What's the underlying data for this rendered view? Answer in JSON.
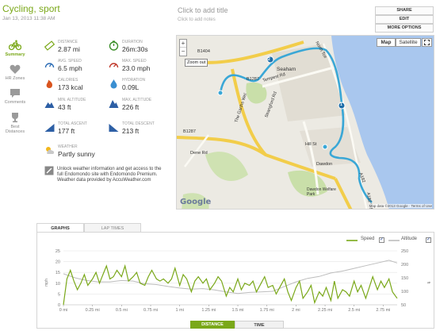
{
  "header": {
    "workout_title": "Cycling, sport",
    "workout_date": "Jan 13, 2013 11:38 AM",
    "add_title": "Click to add title",
    "add_notes": "Click to add notes"
  },
  "actions": [
    "SHARE",
    "EDIT",
    "MORE OPTIONS"
  ],
  "nav": [
    {
      "label": "Summary",
      "icon": "bicycle-icon"
    },
    {
      "label": "HR Zones",
      "icon": "heart-icon"
    },
    {
      "label": "Comments",
      "icon": "comment-icon"
    },
    {
      "label": "Best Distances",
      "icon": "trophy-icon"
    }
  ],
  "stats": [
    {
      "label": "DISTANCE",
      "value": "2.87 mi",
      "icon": "ruler-icon"
    },
    {
      "label": "DURATION",
      "value": "26m:30s",
      "icon": "stopwatch-icon"
    },
    {
      "label": "AVG. SPEED",
      "value": "6.5 mph",
      "icon": "speedometer-icon"
    },
    {
      "label": "MAX. SPEED",
      "value": "23.0 mph",
      "icon": "speedometer-icon"
    },
    {
      "label": "CALORIES",
      "value": "173 kcal",
      "icon": "flame-icon"
    },
    {
      "label": "HYDRATION",
      "value": "0.09L",
      "icon": "water-drop-icon"
    },
    {
      "label": "MIN. ALTITUDE",
      "value": "43 ft",
      "icon": "mountain-icon"
    },
    {
      "label": "MAX. ALTITUDE",
      "value": "226 ft",
      "icon": "mountain-icon"
    },
    {
      "label": "TOTAL ASCENT",
      "value": "177 ft",
      "icon": "ascent-icon"
    },
    {
      "label": "TOTAL DESCENT",
      "value": "213 ft",
      "icon": "descent-icon"
    }
  ],
  "weather": {
    "label": "WEATHER",
    "value": "Partly sunny",
    "icon": "partly-sunny-icon"
  },
  "promo": {
    "line1": "Unlock weather information and get access to the full Endomondo site with Endomondo Premium.",
    "line2": "Weather data provided by AccuWeather.com"
  },
  "map": {
    "map_label": "Map",
    "satellite_label": "Satellite",
    "zoom_out": "Zoom out",
    "zoom_in_symbol": "+",
    "zoom_out_symbol": "−",
    "footer": "Map data ©2013 Google · Terms of Use",
    "google": "Google",
    "places": [
      "Seaham",
      "Dawdon",
      "Dawdon Welfare Park"
    ],
    "roads": [
      "B1404",
      "B1287",
      "B1287",
      "Tempest Rd",
      "The Garths Wel",
      "Dene Rd",
      "A182",
      "Hill St",
      "Strangford Rd",
      "A182 Rd",
      "North Tce"
    ],
    "markers": [
      "2",
      "1"
    ]
  },
  "graph_tabs": [
    "GRAPHS",
    "LAP TIMES"
  ],
  "legend": {
    "speed": "Speed",
    "altitude": "Altitude",
    "check": "✓"
  },
  "axis_toggle": {
    "distance": "DISTANCE",
    "time": "TIME"
  },
  "colors": {
    "accent": "#7aa819",
    "route": "#3aa7d6",
    "altitude": "#bdbdbd"
  },
  "chart_data": {
    "type": "line",
    "x_unit": "mi",
    "xlim": [
      0,
      2.87
    ],
    "x_tick_labels": [
      "0 mi",
      "0.25 mi",
      "0.5 mi",
      "0.75 mi",
      "1 mi",
      "1.25 mi",
      "1.5 mi",
      "1.75 mi",
      "2 mi",
      "2.25 mi",
      "2.5 mi",
      "2.75 mi"
    ],
    "x_ticks": [
      0,
      0.25,
      0.5,
      0.75,
      1,
      1.25,
      1.5,
      1.75,
      2,
      2.25,
      2.5,
      2.75
    ],
    "ylabel": "mph",
    "ylim": [
      0,
      25
    ],
    "y_ticks": [
      0,
      5,
      10,
      15,
      20,
      25
    ],
    "ylabel_right": "ft",
    "ylim_right": [
      50,
      250
    ],
    "y_ticks_right": [
      50,
      100,
      150,
      200,
      250
    ],
    "series": [
      {
        "name": "Speed",
        "axis": "left",
        "x": [
          0,
          0.03,
          0.06,
          0.09,
          0.12,
          0.15,
          0.18,
          0.21,
          0.25,
          0.28,
          0.31,
          0.34,
          0.37,
          0.4,
          0.43,
          0.46,
          0.5,
          0.53,
          0.56,
          0.6,
          0.63,
          0.66,
          0.7,
          0.73,
          0.76,
          0.8,
          0.83,
          0.86,
          0.9,
          0.93,
          0.96,
          1.0,
          1.03,
          1.06,
          1.1,
          1.13,
          1.16,
          1.2,
          1.23,
          1.26,
          1.3,
          1.33,
          1.36,
          1.4,
          1.43,
          1.46,
          1.5,
          1.53,
          1.56,
          1.6,
          1.63,
          1.66,
          1.7,
          1.73,
          1.76,
          1.8,
          1.83,
          1.86,
          1.9,
          1.93,
          1.96,
          2.0,
          2.03,
          2.06,
          2.1,
          2.13,
          2.16,
          2.2,
          2.23,
          2.26,
          2.3,
          2.33,
          2.36,
          2.4,
          2.43,
          2.46,
          2.5,
          2.53,
          2.56,
          2.6,
          2.63,
          2.66,
          2.7,
          2.73,
          2.76,
          2.8,
          2.83,
          2.87
        ],
        "y": [
          0,
          12,
          16,
          11,
          7,
          10,
          14,
          9,
          12,
          15,
          10,
          14,
          18,
          12,
          13,
          16,
          13,
          18,
          11,
          13,
          15,
          10,
          9,
          13,
          16,
          12,
          11,
          12,
          10,
          12,
          17,
          9,
          14,
          12,
          6,
          11,
          13,
          10,
          12,
          7,
          10,
          13,
          11,
          4,
          8,
          6,
          12,
          7,
          10,
          9,
          11,
          6,
          10,
          13,
          8,
          9,
          5,
          8,
          12,
          6,
          2,
          8,
          11,
          3,
          6,
          9,
          1,
          6,
          4,
          8,
          2,
          11,
          3,
          7,
          6,
          4,
          11,
          6,
          9,
          3,
          8,
          13,
          7,
          11,
          8,
          12,
          6,
          3
        ]
      },
      {
        "name": "Altitude",
        "axis": "right",
        "x": [
          0,
          0.1,
          0.2,
          0.3,
          0.4,
          0.5,
          0.6,
          0.7,
          0.8,
          0.9,
          1.0,
          1.1,
          1.2,
          1.3,
          1.4,
          1.5,
          1.6,
          1.7,
          1.8,
          1.9,
          2.0,
          2.1,
          2.2,
          2.3,
          2.4,
          2.5,
          2.6,
          2.7,
          2.8,
          2.87
        ],
        "y": [
          165,
          150,
          140,
          135,
          135,
          140,
          138,
          128,
          125,
          118,
          112,
          108,
          110,
          105,
          98,
          92,
          96,
          98,
          100,
          118,
          135,
          148,
          155,
          168,
          175,
          185,
          195,
          205,
          215,
          205
        ]
      }
    ]
  }
}
